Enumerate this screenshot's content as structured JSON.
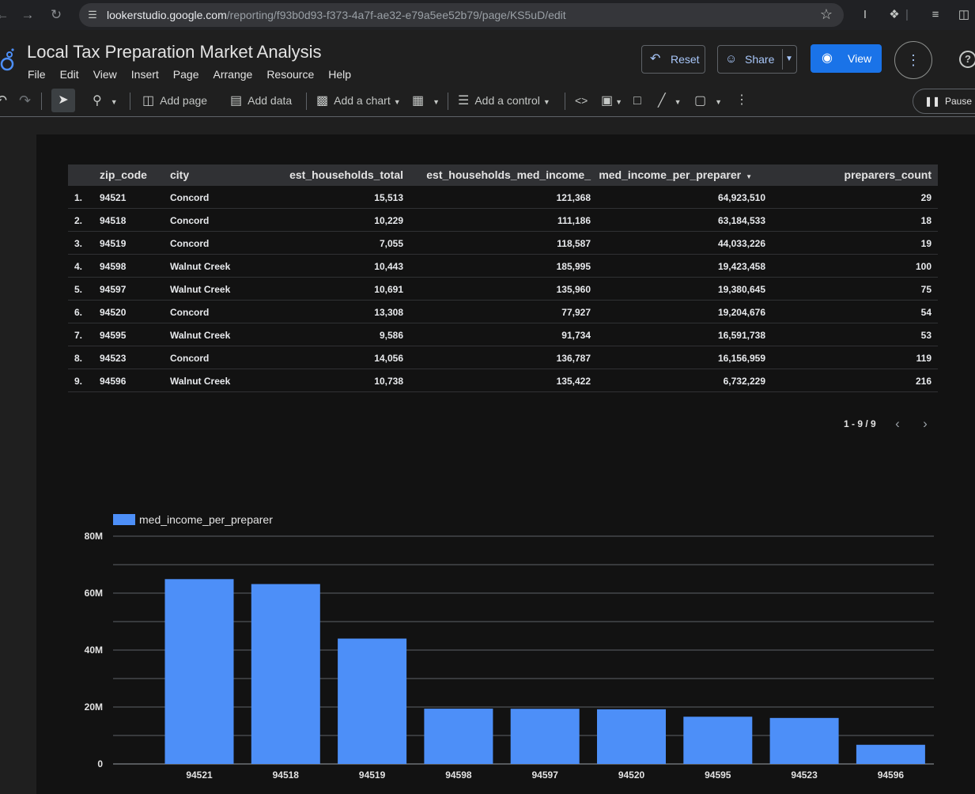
{
  "browser": {
    "url_host": "lookerstudio.google.com",
    "url_path": "/reporting/f93b0d93-f373-4a7f-ae32-e79a5ee52b79/page/KS5uD/edit"
  },
  "app": {
    "title": "Local Tax Preparation Market Analysis",
    "menu": [
      "File",
      "Edit",
      "View",
      "Insert",
      "Page",
      "Arrange",
      "Resource",
      "Help"
    ],
    "reset_label": "Reset",
    "share_label": "Share",
    "view_label": "View"
  },
  "toolbar": {
    "add_page": "Add page",
    "add_data": "Add data",
    "add_chart": "Add a chart",
    "add_control": "Add a control",
    "pause": "Pause u"
  },
  "table": {
    "headers": [
      "zip_code",
      "city",
      "est_households_total",
      "est_households_med_income_",
      "med_income_per_preparer",
      "preparers_count"
    ],
    "rows": [
      [
        "1.",
        "94521",
        "Concord",
        "15,513",
        "121,368",
        "64,923,510",
        "29"
      ],
      [
        "2.",
        "94518",
        "Concord",
        "10,229",
        "111,186",
        "63,184,533",
        "18"
      ],
      [
        "3.",
        "94519",
        "Concord",
        "7,055",
        "118,587",
        "44,033,226",
        "19"
      ],
      [
        "4.",
        "94598",
        "Walnut Creek",
        "10,443",
        "185,995",
        "19,423,458",
        "100"
      ],
      [
        "5.",
        "94597",
        "Walnut Creek",
        "10,691",
        "135,960",
        "19,380,645",
        "75"
      ],
      [
        "6.",
        "94520",
        "Concord",
        "13,308",
        "77,927",
        "19,204,676",
        "54"
      ],
      [
        "7.",
        "94595",
        "Walnut Creek",
        "9,586",
        "91,734",
        "16,591,738",
        "53"
      ],
      [
        "8.",
        "94523",
        "Concord",
        "14,056",
        "136,787",
        "16,156,959",
        "119"
      ],
      [
        "9.",
        "94596",
        "Walnut Creek",
        "10,738",
        "135,422",
        "6,732,229",
        "216"
      ]
    ],
    "pagination": "1 - 9 / 9"
  },
  "chart_data": {
    "type": "bar",
    "categories": [
      "94521",
      "94518",
      "94519",
      "94598",
      "94597",
      "94520",
      "94595",
      "94523",
      "94596"
    ],
    "series": [
      {
        "name": "med_income_per_preparer",
        "values": [
          64923510,
          63184533,
          44033226,
          19423458,
          19380645,
          19204676,
          16591738,
          16156959,
          6732229
        ]
      }
    ],
    "ylim": [
      0,
      80000000
    ],
    "yticks": [
      0,
      20000000,
      40000000,
      60000000,
      80000000
    ],
    "ytick_labels": [
      "0",
      "20M",
      "40M",
      "60M",
      "80M"
    ],
    "grid": true,
    "legend_position": "top-left",
    "bar_color": "#4d8ff8"
  }
}
